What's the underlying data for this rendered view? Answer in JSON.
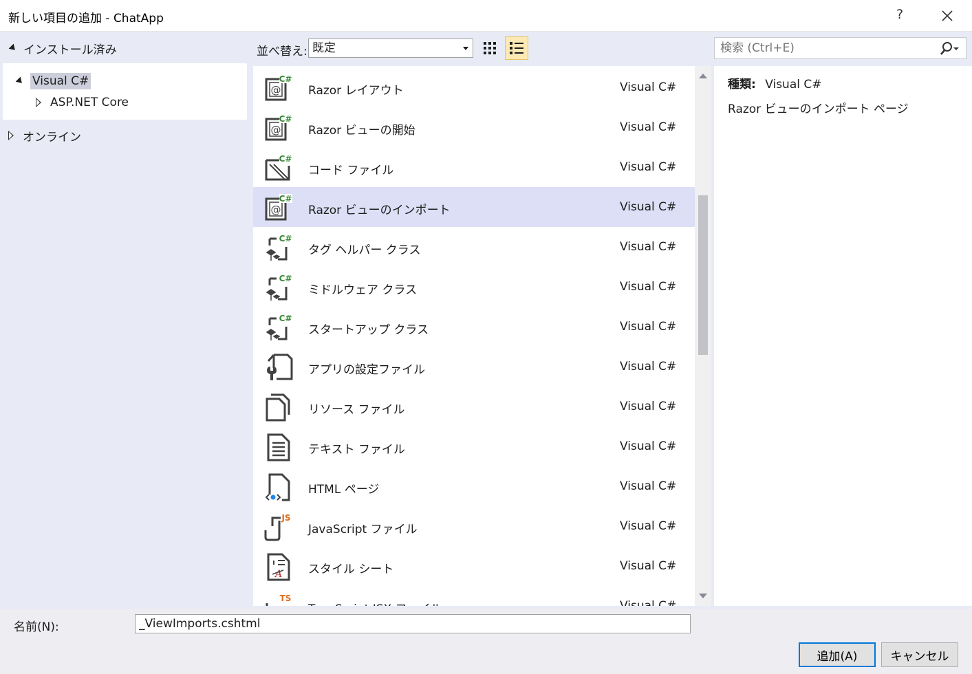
{
  "window": {
    "title": "新しい項目の追加 - ChatApp",
    "help": "?"
  },
  "tree": {
    "installed": "インストール済み",
    "visual_csharp": "Visual C#",
    "aspnet_core": "ASP.NET Core",
    "online": "オンライン"
  },
  "toolbar": {
    "sort_label": "並べ替え:",
    "sort_value": "既定",
    "search_placeholder": "検索 (Ctrl+E)"
  },
  "templates": [
    {
      "name": "Razor レイアウト",
      "lang": "Visual C#",
      "icon": "razor-icon"
    },
    {
      "name": "Razor ビューの開始",
      "lang": "Visual C#",
      "icon": "razor-icon"
    },
    {
      "name": "コード ファイル",
      "lang": "Visual C#",
      "icon": "code-file-icon"
    },
    {
      "name": "Razor ビューのインポート",
      "lang": "Visual C#",
      "icon": "razor-icon",
      "selected": true
    },
    {
      "name": "タグ ヘルパー クラス",
      "lang": "Visual C#",
      "icon": "class-icon"
    },
    {
      "name": "ミドルウェア クラス",
      "lang": "Visual C#",
      "icon": "class-icon"
    },
    {
      "name": "スタートアップ クラス",
      "lang": "Visual C#",
      "icon": "class-icon"
    },
    {
      "name": "アプリの設定ファイル",
      "lang": "Visual C#",
      "icon": "settings-file-icon"
    },
    {
      "name": "リソース ファイル",
      "lang": "Visual C#",
      "icon": "resource-file-icon"
    },
    {
      "name": "テキスト ファイル",
      "lang": "Visual C#",
      "icon": "text-file-icon"
    },
    {
      "name": "HTML ページ",
      "lang": "Visual C#",
      "icon": "html-page-icon"
    },
    {
      "name": "JavaScript ファイル",
      "lang": "Visual C#",
      "icon": "javascript-file-icon"
    },
    {
      "name": "スタイル シート",
      "lang": "Visual C#",
      "icon": "stylesheet-icon"
    },
    {
      "name": "TypeScript JSX ファイル",
      "lang": "Visual C#",
      "icon": "typescript-file-icon"
    }
  ],
  "details": {
    "type_label": "種類:",
    "type_value": "Visual C#",
    "description": "Razor ビューのインポート ページ"
  },
  "footer": {
    "name_label": "名前(N):",
    "name_value": "_ViewImports.cshtml",
    "add_button": "追加(A)",
    "cancel_button": "キャンセル"
  },
  "colors": {
    "selected_row": "#dcdff5",
    "body_bg": "#e8ebf6",
    "csharp_green": "#388a34"
  }
}
